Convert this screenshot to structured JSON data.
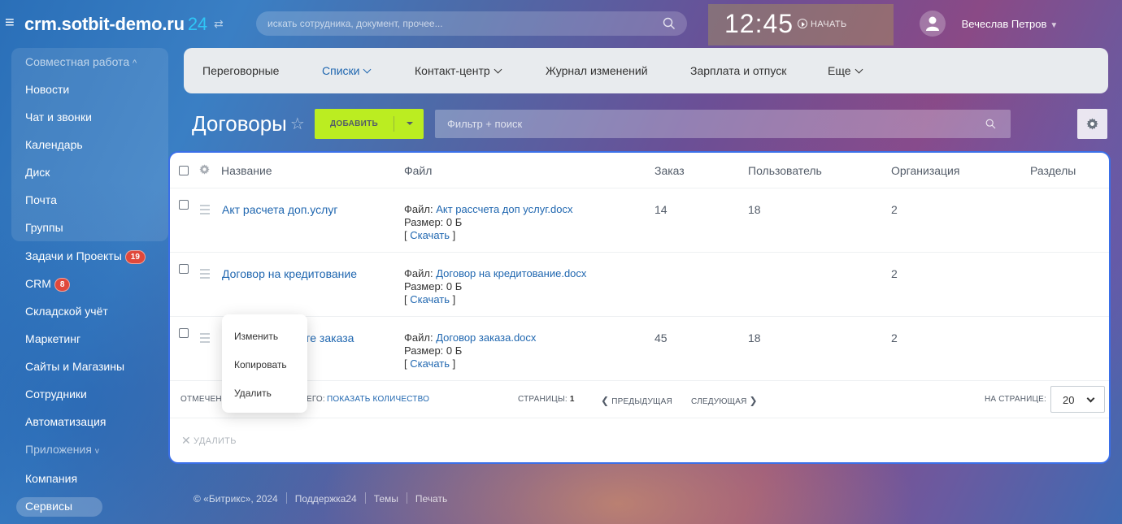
{
  "header": {
    "portal_name": "crm.sotbit-demo.ru",
    "portal_suffix": "24",
    "swap_glyph": "⇄",
    "search_placeholder": "искать сотрудника, документ, прочее...",
    "clock": "12:45",
    "start_label": "НАЧАТЬ",
    "user_name": "Вечеслав Петров"
  },
  "sidebar": {
    "group_title": "Совместная работа",
    "items": [
      {
        "label": "Новости"
      },
      {
        "label": "Чат и звонки"
      },
      {
        "label": "Календарь"
      },
      {
        "label": "Диск"
      },
      {
        "label": "Почта"
      },
      {
        "label": "Группы"
      },
      {
        "label": "Задачи и Проекты",
        "badge": "19"
      },
      {
        "label": "CRM",
        "badge": "8"
      },
      {
        "label": "Складской учёт"
      },
      {
        "label": "Маркетинг"
      },
      {
        "label": "Сайты и Магазины"
      },
      {
        "label": "Сотрудники"
      },
      {
        "label": "Автоматизация"
      },
      {
        "label": "Приложения"
      },
      {
        "label": "Компания"
      },
      {
        "label": "Сервисы"
      }
    ]
  },
  "topnav": {
    "tabs": [
      {
        "label": "Переговорные"
      },
      {
        "label": "Списки"
      },
      {
        "label": "Контакт-центр"
      },
      {
        "label": "Журнал изменений"
      },
      {
        "label": "Зарплата и отпуск"
      },
      {
        "label": "Еще"
      }
    ]
  },
  "page": {
    "title": "Договоры",
    "add_label": "ДОБАВИТЬ",
    "filter_placeholder": "Фильтр + поиск"
  },
  "grid": {
    "columns": [
      "Название",
      "Файл",
      "Заказ",
      "Пользователь",
      "Организация",
      "Разделы"
    ],
    "file_prefix": "Файл:",
    "download_label": "Скачать",
    "rows": [
      {
        "name": "Акт расчета доп.услуг",
        "file": "Акт рассчета доп услуг.docx",
        "size": "Размер: 0 Б",
        "order": "14",
        "user": "18",
        "org": "2"
      },
      {
        "name": "Договор на кредитование",
        "file": "Договор на кредитование.docx",
        "size": "Размер: 0 Б",
        "order": "",
        "user": "",
        "org": "2"
      },
      {
        "name": "те заказа",
        "file": "Договор заказа.docx",
        "size": "Размер: 0 Б",
        "order": "45",
        "user": "18",
        "org": "2"
      }
    ],
    "footer": {
      "checked_label": "ОТМЕЧЕН",
      "total_suffix": "ЕГО:",
      "show_count": "ПОКАЗАТЬ КОЛИЧЕСТВО",
      "pages_label": "СТРАНИЦЫ:",
      "current_page": "1",
      "prev_label": "ПРЕДЫДУЩАЯ",
      "next_label": "СЛЕДУЮЩАЯ",
      "per_page_label": "НА СТРАНИЦЕ:",
      "per_page_value": "20"
    },
    "delete_label": "УДАЛИТЬ"
  },
  "context_menu": {
    "items": [
      "Изменить",
      "Копировать",
      "Удалить"
    ]
  },
  "footer": {
    "copyright": "© «Битрикс», 2024",
    "links": [
      "Поддержка24",
      "Темы",
      "Печать"
    ]
  },
  "colors": {
    "accent": "#2067b0",
    "add_button": "#bbed21",
    "grid_border": "#3a6fe8",
    "badge": "#e0483b",
    "portal_suffix": "#2fc6f6"
  }
}
